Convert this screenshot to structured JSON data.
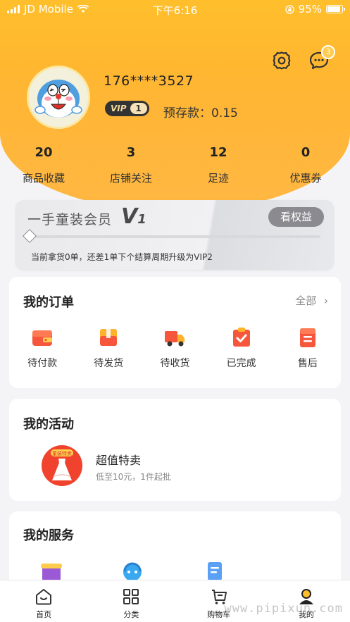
{
  "status_bar": {
    "carrier": "JD Mobile",
    "time": "下午6:16",
    "battery": "95%"
  },
  "header": {
    "message_count": "3"
  },
  "user": {
    "phone": "176****3527",
    "vip_label": "VIP",
    "vip_level": "1",
    "deposit": "预存款：0.15"
  },
  "stats": [
    {
      "value": "20",
      "label": "商品收藏"
    },
    {
      "value": "3",
      "label": "店铺关注"
    },
    {
      "value": "12",
      "label": "足迹"
    },
    {
      "value": "0",
      "label": "优惠券"
    }
  ],
  "membership": {
    "title": "一手童装会员",
    "level_prefix": "V",
    "level_num": "1",
    "rights_button": "看权益",
    "note": "当前拿货0单，还差1单下个结算周期升级为VIP2",
    "progress_fraction": 0
  },
  "orders": {
    "title": "我的订单",
    "all_label": "全部",
    "items": [
      {
        "label": "待付款",
        "icon": "wallet-icon"
      },
      {
        "label": "待发货",
        "icon": "package-icon"
      },
      {
        "label": "待收货",
        "icon": "truck-icon"
      },
      {
        "label": "已完成",
        "icon": "clipboard-check-icon"
      },
      {
        "label": "售后",
        "icon": "receipt-icon"
      }
    ]
  },
  "activities": {
    "title": "我的活动",
    "item": {
      "badge": "童装特卖",
      "title": "超值特卖",
      "subtitle": "低至10元，1件起批"
    }
  },
  "services": {
    "title": "我的服务"
  },
  "bottom_nav": [
    {
      "label": "首页",
      "icon": "home-icon"
    },
    {
      "label": "分类",
      "icon": "category-icon"
    },
    {
      "label": "购物车",
      "icon": "cart-icon"
    },
    {
      "label": "我的",
      "icon": "profile-icon"
    }
  ],
  "watermark": "www.pipixun.com",
  "colors": {
    "brand_yellow": "#ffb631",
    "order_red": "#f5563c",
    "order_orange": "#ffb22e"
  }
}
